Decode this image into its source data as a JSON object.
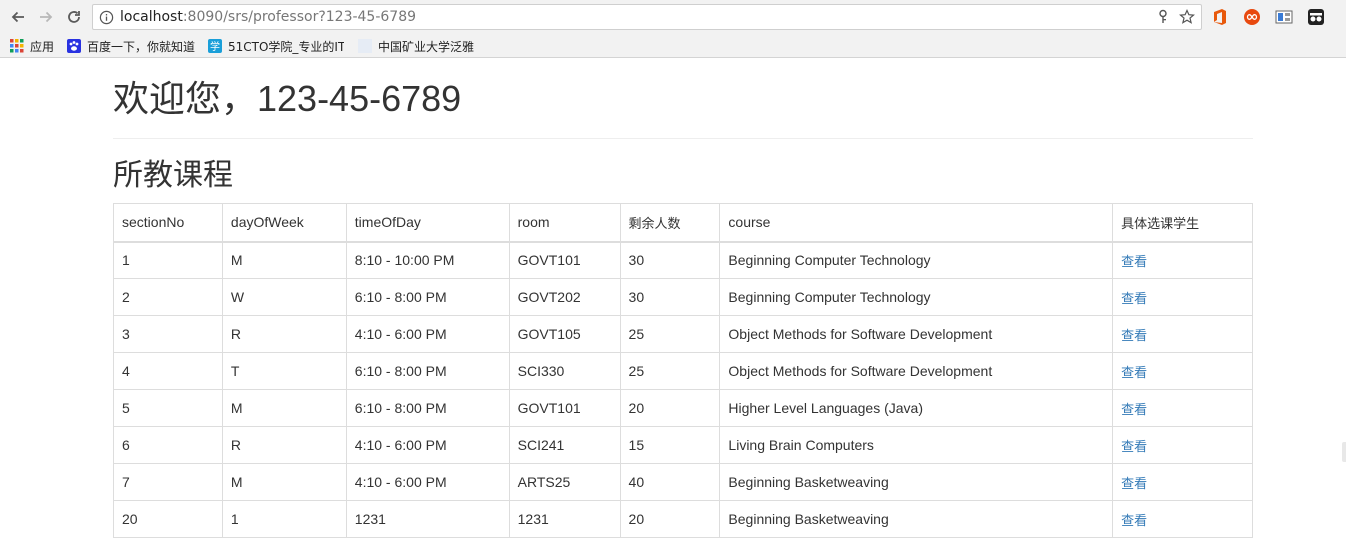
{
  "browser": {
    "url_host": "localhost",
    "url_path": ":8090/srs/professor?123-45-6789",
    "bookmarks": [
      {
        "label": "应用",
        "icon": "apps-grid-icon"
      },
      {
        "label": "百度一下，你就知道",
        "icon": "baidu-paw-icon"
      },
      {
        "label": "51CTO学院_专业的IT",
        "icon": "51cto-icon"
      },
      {
        "label": "中国矿业大学泛雅",
        "icon": "blank-favicon-icon"
      }
    ],
    "extensions": [
      "office-icon",
      "infinity-extension-icon",
      "screenshot-extension-icon",
      "incognito-icon"
    ]
  },
  "page": {
    "welcome": "欢迎您，123-45-6789",
    "section_title": "所教课程",
    "table": {
      "headers": [
        "sectionNo",
        "dayOfWeek",
        "timeOfDay",
        "room",
        "剩余人数",
        "course",
        "具体选课学生"
      ],
      "rows": [
        {
          "sectionNo": "1",
          "dayOfWeek": "M",
          "timeOfDay": "8:10 - 10:00 PM",
          "room": "GOVT101",
          "remaining": "30",
          "course": "Beginning Computer Technology",
          "link": "查看"
        },
        {
          "sectionNo": "2",
          "dayOfWeek": "W",
          "timeOfDay": "6:10 - 8:00 PM",
          "room": "GOVT202",
          "remaining": "30",
          "course": "Beginning Computer Technology",
          "link": "查看"
        },
        {
          "sectionNo": "3",
          "dayOfWeek": "R",
          "timeOfDay": "4:10 - 6:00 PM",
          "room": "GOVT105",
          "remaining": "25",
          "course": "Object Methods for Software Development",
          "link": "查看"
        },
        {
          "sectionNo": "4",
          "dayOfWeek": "T",
          "timeOfDay": "6:10 - 8:00 PM",
          "room": "SCI330",
          "remaining": "25",
          "course": "Object Methods for Software Development",
          "link": "查看"
        },
        {
          "sectionNo": "5",
          "dayOfWeek": "M",
          "timeOfDay": "6:10 - 8:00 PM",
          "room": "GOVT101",
          "remaining": "20",
          "course": "Higher Level Languages (Java)",
          "link": "查看"
        },
        {
          "sectionNo": "6",
          "dayOfWeek": "R",
          "timeOfDay": "4:10 - 6:00 PM",
          "room": "SCI241",
          "remaining": "15",
          "course": "Living Brain Computers",
          "link": "查看"
        },
        {
          "sectionNo": "7",
          "dayOfWeek": "M",
          "timeOfDay": "4:10 - 6:00 PM",
          "room": "ARTS25",
          "remaining": "40",
          "course": "Beginning Basketweaving",
          "link": "查看"
        },
        {
          "sectionNo": "20",
          "dayOfWeek": "1",
          "timeOfDay": "1231",
          "room": "1231",
          "remaining": "20",
          "course": "Beginning Basketweaving",
          "link": "查看"
        }
      ]
    }
  },
  "colors": {
    "link": "#337ab7",
    "text": "#333333",
    "border": "#dddddd"
  }
}
